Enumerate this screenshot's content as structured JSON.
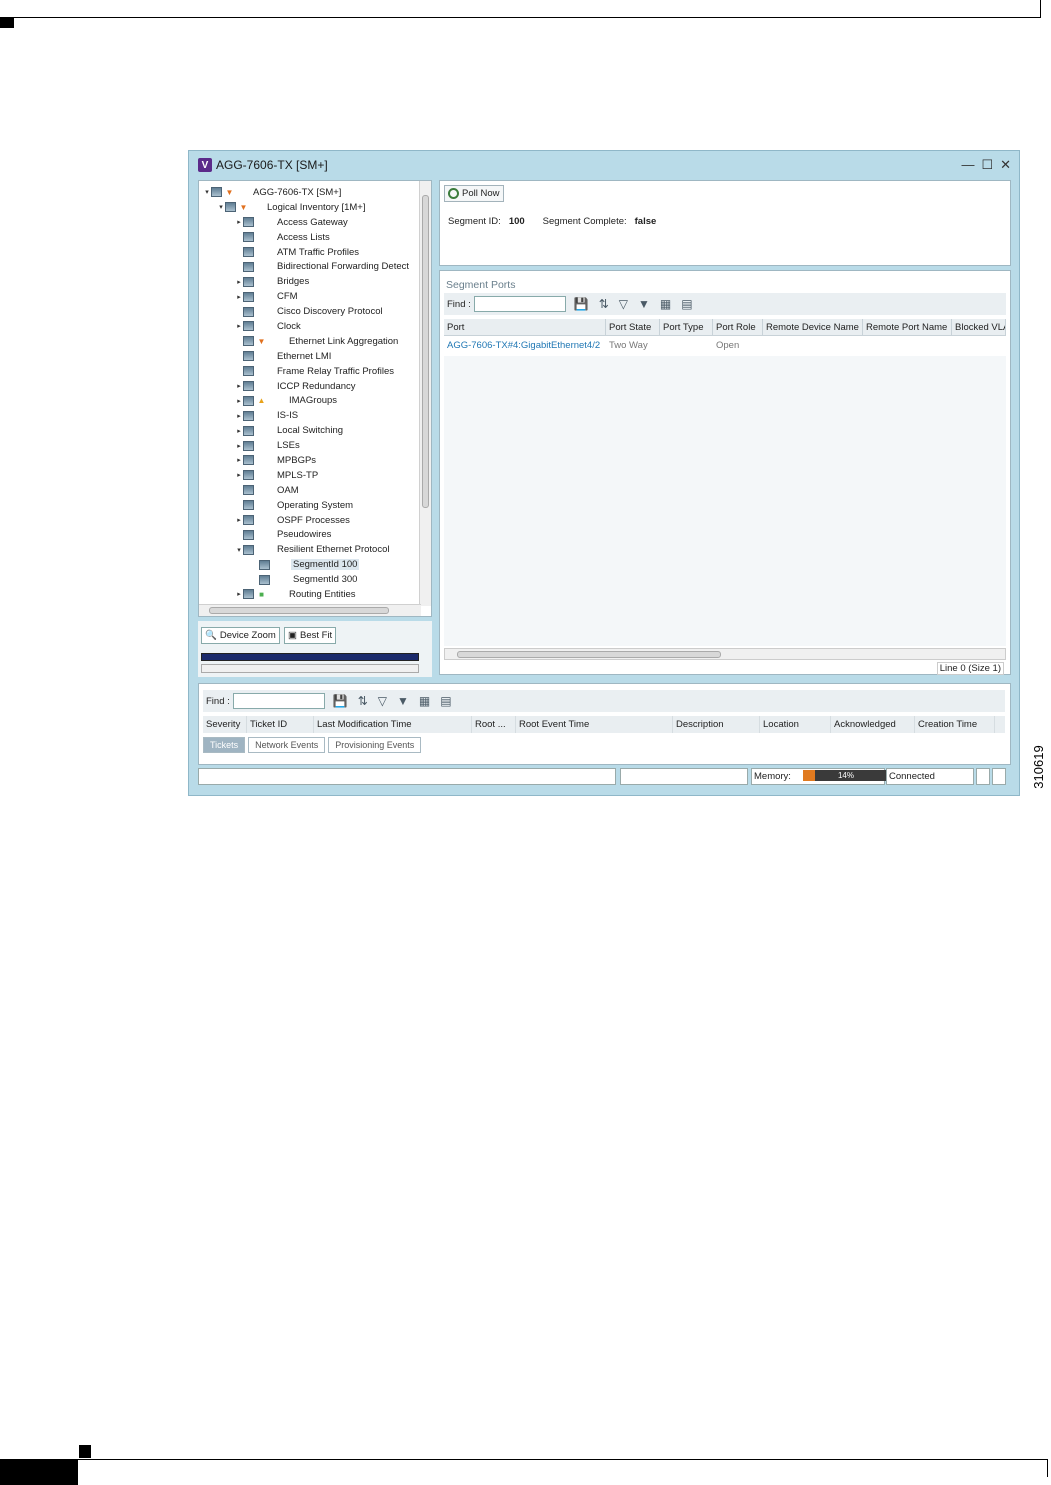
{
  "figure_id": "310619",
  "window": {
    "app_icon_letter": "V",
    "title": "AGG-7606-TX [SM+]",
    "minimize": "—",
    "maximize": "☐",
    "close": "✕"
  },
  "tree": {
    "items": [
      {
        "label": "AGG-7606-TX [SM+]",
        "level": 0,
        "expander": "▾",
        "badge": "▼",
        "badge_color": "#e0701f"
      },
      {
        "label": "Logical Inventory [1M+]",
        "level": 1,
        "expander": "▾",
        "badge": "▼",
        "badge_color": "#e0701f"
      },
      {
        "label": "Access Gateway",
        "level": 2,
        "expander": "▸"
      },
      {
        "label": "Access Lists",
        "level": 2,
        "expander": ""
      },
      {
        "label": "ATM Traffic Profiles",
        "level": 2,
        "expander": ""
      },
      {
        "label": "Bidirectional Forwarding Detect",
        "level": 2,
        "expander": ""
      },
      {
        "label": "Bridges",
        "level": 2,
        "expander": "▸"
      },
      {
        "label": "CFM",
        "level": 2,
        "expander": "▸"
      },
      {
        "label": "Cisco Discovery Protocol",
        "level": 2,
        "expander": ""
      },
      {
        "label": "Clock",
        "level": 2,
        "expander": "▸"
      },
      {
        "label": "Ethernet Link Aggregation",
        "level": 2,
        "expander": "",
        "badge": "▼",
        "badge_color": "#e0701f"
      },
      {
        "label": "Ethernet LMI",
        "level": 2,
        "expander": ""
      },
      {
        "label": "Frame Relay Traffic Profiles",
        "level": 2,
        "expander": ""
      },
      {
        "label": "ICCP Redundancy",
        "level": 2,
        "expander": "▸"
      },
      {
        "label": "IMAGroups",
        "level": 2,
        "expander": "▸",
        "badge": "▲",
        "badge_color": "#e8a21a"
      },
      {
        "label": "IS-IS",
        "level": 2,
        "expander": "▸"
      },
      {
        "label": "Local Switching",
        "level": 2,
        "expander": "▸"
      },
      {
        "label": "LSEs",
        "level": 2,
        "expander": "▸"
      },
      {
        "label": "MPBGPs",
        "level": 2,
        "expander": "▸"
      },
      {
        "label": "MPLS-TP",
        "level": 2,
        "expander": "▸"
      },
      {
        "label": "OAM",
        "level": 2,
        "expander": ""
      },
      {
        "label": "Operating System",
        "level": 2,
        "expander": ""
      },
      {
        "label": "OSPF Processes",
        "level": 2,
        "expander": "▸"
      },
      {
        "label": "Pseudowires",
        "level": 2,
        "expander": ""
      },
      {
        "label": "Resilient Ethernet Protocol",
        "level": 2,
        "expander": "▾"
      },
      {
        "label": "SegmentId 100",
        "level": 3,
        "expander": "",
        "selected": true
      },
      {
        "label": "SegmentId 300",
        "level": 3,
        "expander": ""
      },
      {
        "label": "Routing Entities",
        "level": 2,
        "expander": "▸",
        "badge": "■",
        "badge_color": "#4caf50"
      }
    ]
  },
  "zoom": {
    "device_zoom_label": "Device Zoom",
    "best_fit_label": "Best Fit"
  },
  "segment": {
    "poll_now_label": "Poll Now",
    "segment_id_label": "Segment ID:",
    "segment_id_value": "100",
    "segment_complete_label": "Segment Complete:",
    "segment_complete_value": "false"
  },
  "segment_ports": {
    "title": "Segment Ports",
    "find_label": "Find :",
    "columns": [
      "Port",
      "Port State",
      "Port Type",
      "Port Role",
      "Remote Device Name",
      "Remote Port Name",
      "Blocked VLA"
    ],
    "rows": [
      {
        "port": "AGG-7606-TX#4:GigabitEthernet4/2",
        "port_state": "Two Way",
        "port_type": "",
        "port_role": "Open",
        "remote_device_name": "",
        "remote_port_name": "",
        "blocked_vlan": ""
      }
    ],
    "line_info": "Line 0 (Size 1)"
  },
  "tickets": {
    "find_label": "Find :",
    "columns": [
      "Severity",
      "Ticket ID",
      "Last Modification Time",
      "Root ...",
      "Root Event Time",
      "Description",
      "Location",
      "Acknowledged",
      "Creation Time"
    ],
    "tabs": [
      "Tickets",
      "Network Events",
      "Provisioning Events"
    ],
    "active_tab": "Tickets"
  },
  "status": {
    "memory_label": "Memory:",
    "memory_percent": 14,
    "memory_text": "14%",
    "connection": "Connected"
  }
}
